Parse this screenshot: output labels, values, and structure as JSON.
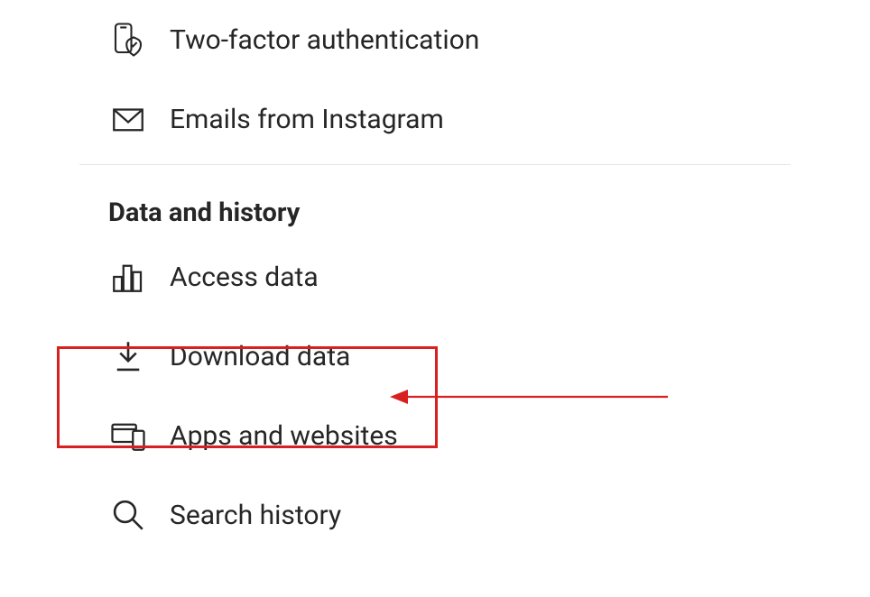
{
  "security_section": {
    "items": [
      {
        "label": "Two-factor authentication"
      },
      {
        "label": "Emails from Instagram"
      }
    ]
  },
  "data_section": {
    "header": "Data and history",
    "items": [
      {
        "label": "Access data"
      },
      {
        "label": "Download data"
      },
      {
        "label": "Apps and websites"
      },
      {
        "label": "Search history"
      }
    ]
  },
  "annotation": {
    "highlight_color": "#d82020"
  }
}
